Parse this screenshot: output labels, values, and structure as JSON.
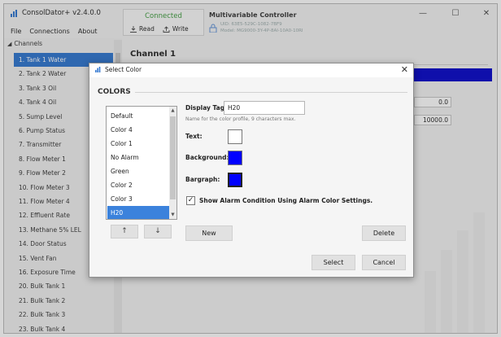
{
  "app": {
    "title": "ConsolDator+ v2.4.0.0",
    "menu": [
      "File",
      "Connections",
      "About"
    ],
    "status": "Connected",
    "read_label": "Read",
    "write_label": "Write",
    "device_name": "Multivariable Controller",
    "device_uid": "UID: 63E5-529C-1082-7BF9",
    "device_model": "Model: MG9000-3Y-4P-8AI-10A0-10RI",
    "window_controls": [
      "minimize-icon",
      "maximize-icon",
      "close-icon"
    ]
  },
  "sidebar": {
    "header": "Channels",
    "items": [
      "1. Tank 1 Water",
      "2. Tank 2 Water",
      "3. Tank 3 Oil",
      "4. Tank 4 Oil",
      "5. Sump Level",
      "6. Pump Status",
      "7. Transmitter",
      "8. Flow Meter 1",
      "9. Flow Meter 2",
      "10. Flow Meter 3",
      "11. Flow Meter 4",
      "12. Effluent Rate",
      "13. Methane 5% LEL",
      "14. Door Status",
      "15. Vent Fan",
      "16. Exposure Time",
      "20. Bulk Tank 1",
      "21. Bulk Tank 2",
      "22. Bulk Tank 3",
      "23. Bulk Tank 4"
    ],
    "selected_index": 0
  },
  "main": {
    "channel_title": "Channel 1",
    "value_low": "0.0",
    "value_high": "10000.0"
  },
  "dialog": {
    "title": "Select Color",
    "section": "COLORS",
    "list_items": [
      "Default",
      "Color 4",
      "Color 1",
      "No Alarm",
      "Green",
      "Color 2",
      "Color 3",
      "H20"
    ],
    "selected_index": 7,
    "up_arrow": "↑",
    "down_arrow": "↓",
    "display_tag_label": "Display Tag:",
    "display_tag_value": "H20",
    "display_tag_hint": "Name for the color profile, 9 characters max.",
    "text_label": "Text:",
    "background_label": "Background:",
    "bargraph_label": "Bargraph:",
    "checkbox_checked": true,
    "checkbox_label": "Show Alarm Condition Using Alarm Color Settings.",
    "new_label": "New",
    "delete_label": "Delete",
    "select_label": "Select",
    "cancel_label": "Cancel",
    "colors": {
      "text": "#ffffff",
      "background": "#0000ff",
      "bargraph": "#0000ff"
    }
  },
  "colors": {
    "accent": "#2a72cf",
    "status_connected": "#3a9a3a",
    "channel_bar": "#0000c8"
  }
}
